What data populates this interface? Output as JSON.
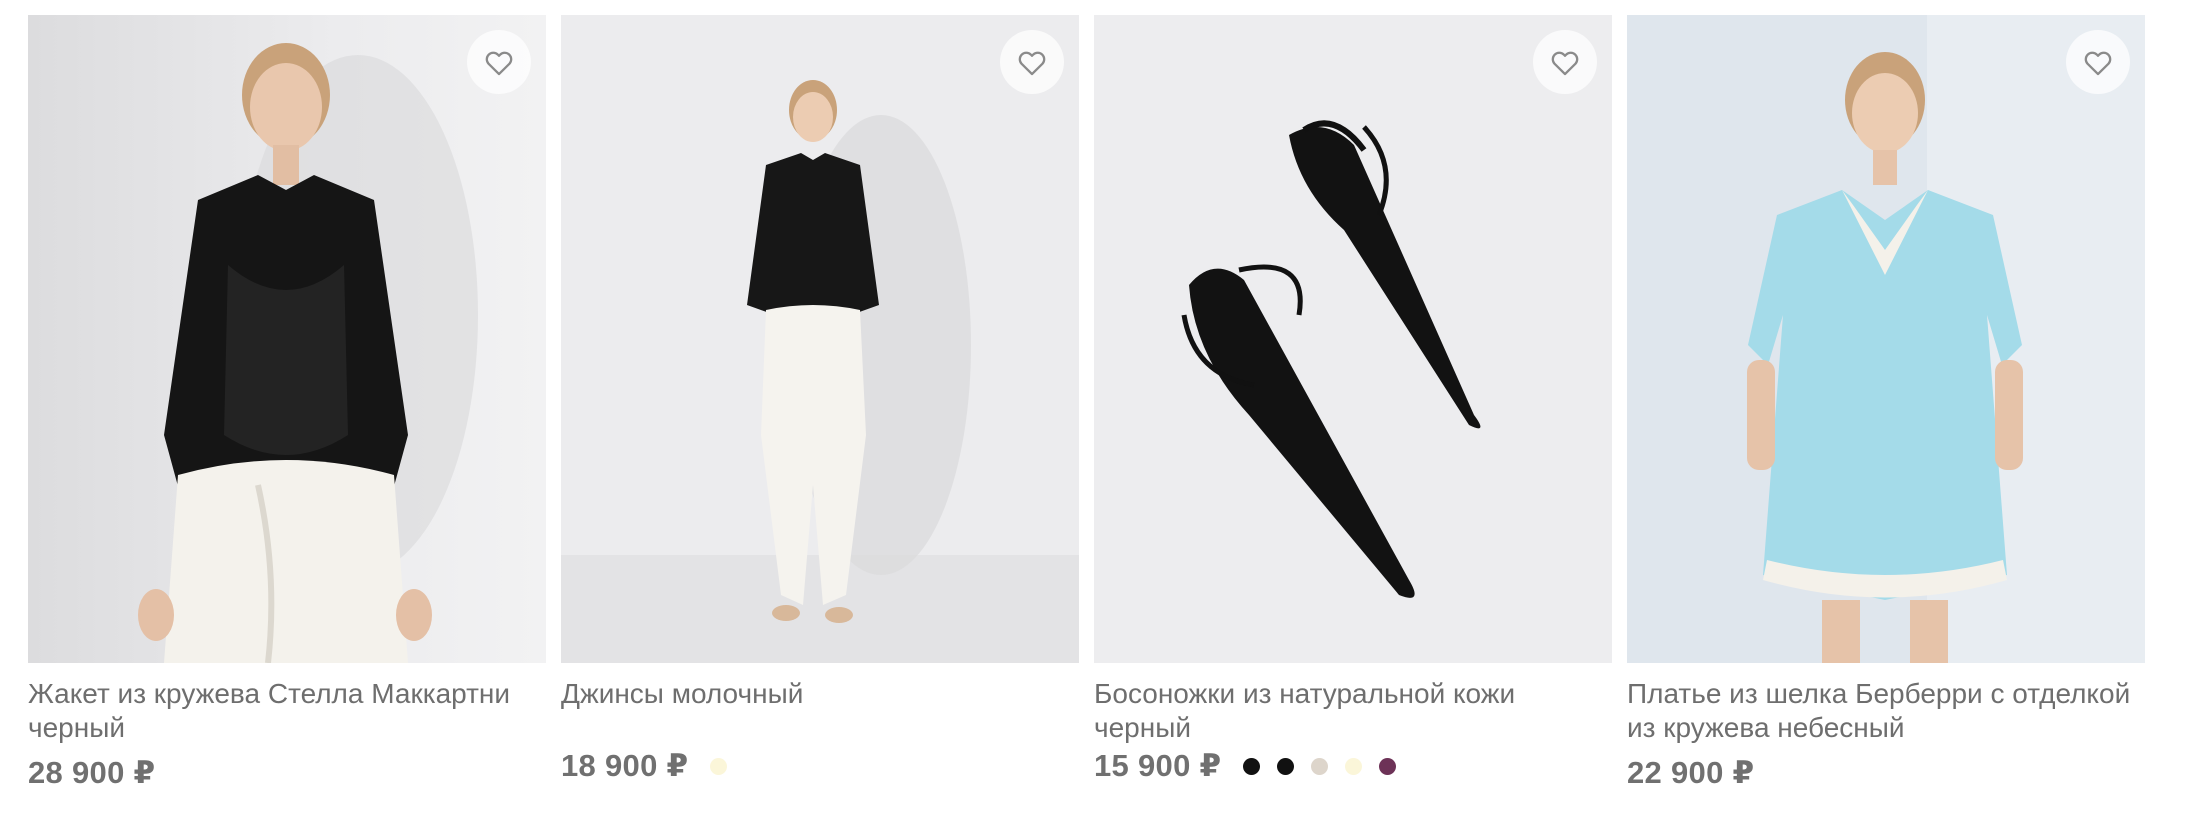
{
  "products": [
    {
      "title": "Жакет из кружева Стелла Маккартни черный",
      "price": "28 900 ₽",
      "image_icon": "model-lace-jacket-photo",
      "image_bg": "#e5e5e7",
      "swatches": []
    },
    {
      "title": "Джинсы молочный",
      "price": "18 900 ₽",
      "image_icon": "model-milk-trousers-photo",
      "image_bg": "#ebebed",
      "swatches": [
        "#fbf6d9"
      ]
    },
    {
      "title": "Босоножки из натуральной кожи черный",
      "price": "15 900 ₽",
      "image_icon": "black-sandals-photo",
      "image_bg": "#ececee",
      "swatches": [
        "#111111",
        "#111111",
        "#ddd5cb",
        "#fbf6d9",
        "#6d3257"
      ]
    },
    {
      "title": "Платье из шелка Берберри с отделкой из кружева небесный",
      "price": "22 900 ₽",
      "image_icon": "model-sky-blue-dress-photo",
      "image_bg": "#dde6ee",
      "swatches": []
    }
  ],
  "favorite_icon": "heart-outline-icon"
}
